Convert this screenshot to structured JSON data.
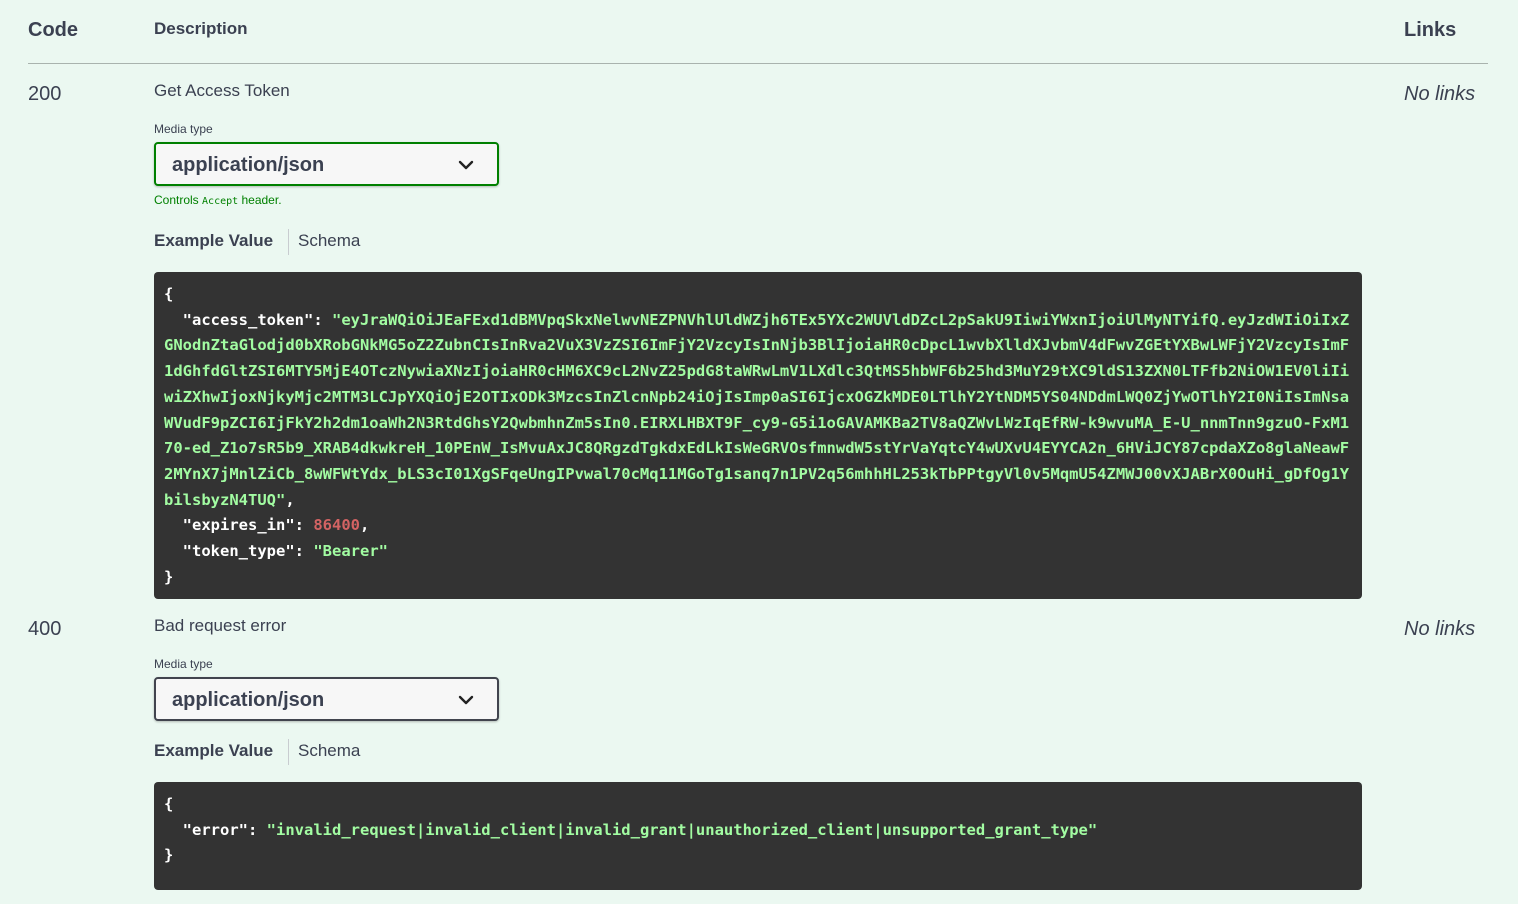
{
  "table_header": {
    "code": "Code",
    "description": "Description",
    "links": "Links"
  },
  "responses": [
    {
      "code": "200",
      "description": "Get Access Token",
      "links": "No links",
      "media_type_label": "Media type",
      "media_type": "application/json",
      "controls_pre": "Controls ",
      "controls_code": "Accept",
      "controls_post": " header.",
      "tab_example": "Example Value",
      "tab_schema": "Schema",
      "example": {
        "open": "{",
        "close": "}",
        "access_token_key": "\"access_token\"",
        "access_token_value": "\"eyJraWQiOiJEaFExd1dBMVpqSkxNelwvNEZPNVhlUldWZjh6TEx5YXc2WUVldDZcL2pSakU9IiwiYWxnIjoiUlMyNTYifQ.eyJzdWIiOiIxZGNodnZtaGlodjd0bXRobGNkMG5oZ2ZubnCIsInRva2VuX3VzZSI6ImFjY2VzcyIsInNjb3BlIjoiaHR0cDpcL1wvbXlldXJvbmV4dFwvZGEtYXBwLWFjY2VzcyIsImF1dGhfdGltZSI6MTY5MjE4OTczNywiaXNzIjoiaHR0cHM6XC9cL2NvZ25pdG8taWRwLmV1LXdlc3QtMS5hbWF6b25hd3MuY29tXC9ldS13ZXN0LTFfb2NiOW1EV0liIiwiZXhwIjoxNjkyMjc2MTM3LCJpYXQiOjE2OTIxODk3MzcsInZlcnNpb24iOjIsImp0aSI6IjcxOGZkMDE0LTlhY2YtNDM5YS04NDdmLWQ0ZjYwOTlhY2I0NiIsImNsaWVudF9pZCI6IjFkY2h2dm1oaWh2N3RtdGhsY2QwbmhnZm5sIn0.EIRXLHBXT9F_cy9-G5i1oGAVAMKBa2TV8aQZWvLWzIqEfRW-k9wvuMA_E-U_nnmTnn9gzuO-FxM170-ed_Z1o7sR5b9_XRAB4dkwkreH_10PEnW_IsMvuAxJC8QRgzdTgkdxEdLkIsWeGRVOsfmnwdW5stYrVaYqtcY4wUXvU4EYYCA2n_6HViJCY87cpdaXZo8glaNeawF2MYnX7jMnlZiCb_8wWFWtYdx_bLS3cI01XgSFqeUngIPvwal70cMq11MGoTg1sanq7n1PV2q56mhhHL253kTbPPtgyVl0v5MqmU54ZMWJ00vXJABrX0OuHi_gDfOg1YbilsbyzN4TUQ\"",
        "expires_in_key": "\"expires_in\"",
        "expires_in_value": "86400",
        "token_type_key": "\"token_type\"",
        "token_type_value": "\"Bearer\""
      }
    },
    {
      "code": "400",
      "description": "Bad request error",
      "links": "No links",
      "media_type_label": "Media type",
      "media_type": "application/json",
      "tab_example": "Example Value",
      "tab_schema": "Schema",
      "example": {
        "open": "{",
        "close": "}",
        "error_key": "\"error\"",
        "error_value": "\"invalid_request|invalid_client|invalid_grant|unauthorized_client|unsupported_grant_type\""
      }
    }
  ],
  "colors": {
    "background": "#ebf8f1",
    "code_bg": "#333333",
    "string": "#a2fca2",
    "number": "#d36363",
    "active_border": "#008000"
  },
  "icons": {
    "select_chevron": "chevron-down-icon"
  }
}
